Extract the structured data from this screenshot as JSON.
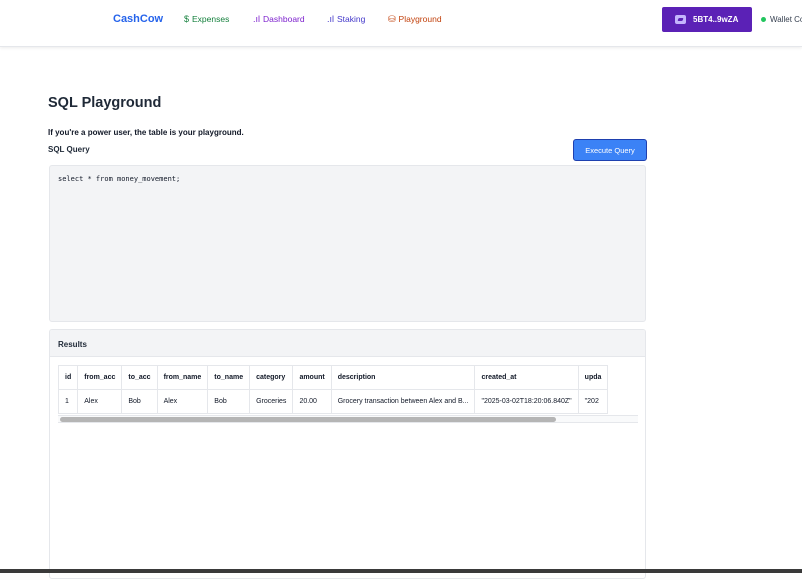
{
  "nav": {
    "brand": "CashCow",
    "items": [
      {
        "label": "Expenses",
        "icon": "dollar-icon",
        "glyph": "$",
        "color": "#15803d"
      },
      {
        "label": "Dashboard",
        "icon": "bar-chart-icon",
        "glyph": ".ıl",
        "color": "#7e22ce"
      },
      {
        "label": "Staking",
        "icon": "bar-chart-icon",
        "glyph": ".ıl",
        "color": "#4338ca"
      },
      {
        "label": "Playground",
        "icon": "database-icon",
        "glyph": "⛁",
        "color": "#c2410c"
      }
    ],
    "wallet_label": "5BT4..9wZA",
    "wallet_status": "Wallet Co",
    "accent": "#5b21b6"
  },
  "page": {
    "title": "SQL Playground",
    "subtitle": "If you're a power user, the table is your playground.",
    "query_label": "SQL Query",
    "execute_label": "Execute Query",
    "query": "select * from money_movement;"
  },
  "results": {
    "title": "Results",
    "columns": [
      "id",
      "from_acc",
      "to_acc",
      "from_name",
      "to_name",
      "category",
      "amount",
      "description",
      "created_at",
      "upda"
    ],
    "rows": [
      [
        "1",
        "Alex",
        "Bob",
        "Alex",
        "Bob",
        "Groceries",
        "20.00",
        "Grocery transaction between Alex and B...",
        "\"2025-03-02T18:20:06.840Z\"",
        "\"202"
      ]
    ]
  }
}
